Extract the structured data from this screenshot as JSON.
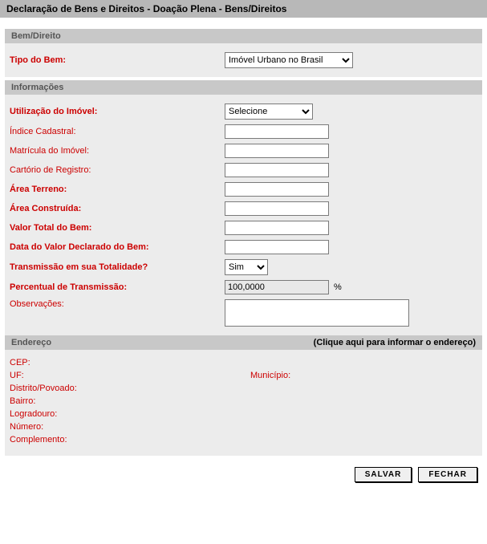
{
  "header": "Declaração de Bens e Direitos - Doação Plena - Bens/Direitos",
  "sections": {
    "bem_direito": "Bem/Direito",
    "informacoes": "Informações",
    "endereco": "Endereço",
    "endereco_link": "(Clique aqui para informar o endereço)"
  },
  "labels": {
    "tipo_bem": "Tipo do Bem:",
    "utilizacao": "Utilização do Imóvel:",
    "indice": "Índice Cadastral:",
    "matricula": "Matrícula do Imóvel:",
    "cartorio": "Cartório de Registro:",
    "area_terreno": "Área Terreno:",
    "area_construida": "Área Construída:",
    "valor_total": "Valor Total do Bem:",
    "data_valor": "Data do Valor Declarado do Bem:",
    "transmissao_total": "Transmissão em sua Totalidade?",
    "percentual": "Percentual de Transmissão:",
    "observacoes": "Observações:",
    "pct_sign": "%"
  },
  "values": {
    "tipo_bem": "Imóvel Urbano no Brasil",
    "utilizacao": "Selecione",
    "indice": "",
    "matricula": "",
    "cartorio": "",
    "area_terreno": "",
    "area_construida": "",
    "valor_total": "",
    "data_valor": "",
    "transmissao_total": "Sim",
    "percentual": "100,0000",
    "observacoes": ""
  },
  "endereco": {
    "cep": "CEP:",
    "uf": "UF:",
    "municipio": "Município:",
    "distrito": "Distrito/Povoado:",
    "bairro": "Bairro:",
    "logradouro": "Logradouro:",
    "numero": "Número:",
    "complemento": "Complemento:"
  },
  "buttons": {
    "salvar": "Salvar",
    "fechar": "Fechar"
  }
}
